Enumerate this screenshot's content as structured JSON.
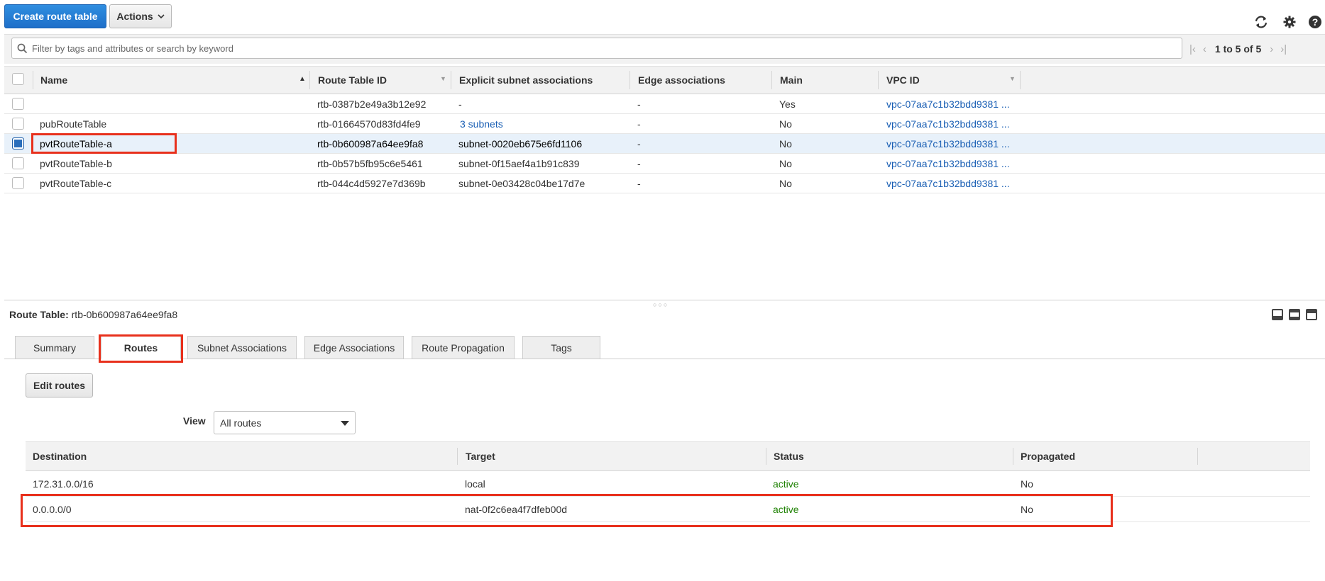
{
  "toolbar": {
    "create_label": "Create route table",
    "actions_label": "Actions",
    "icons": [
      "refresh-icon",
      "gear-icon",
      "help-icon"
    ]
  },
  "filter": {
    "placeholder": "Filter by tags and attributes or search by keyword",
    "pagination": "1 to 5 of 5"
  },
  "table": {
    "columns": {
      "name": "Name",
      "route_table_id": "Route Table ID",
      "explicit_subnet": "Explicit subnet associations",
      "edge": "Edge associations",
      "main": "Main",
      "vpc_id": "VPC ID"
    },
    "rows": [
      {
        "name": "",
        "id": "rtb-0387b2e49a3b12e92",
        "subnets": "-",
        "edge": "-",
        "main": "Yes",
        "vpc": "vpc-07aa7c1b32bdd9381 ..."
      },
      {
        "name": "pubRouteTable",
        "id": "rtb-01664570d83fd4fe9",
        "subnets": "3 subnets",
        "edge": "-",
        "main": "No",
        "vpc": "vpc-07aa7c1b32bdd9381 ..."
      },
      {
        "name": "pvtRouteTable-a",
        "id": "rtb-0b600987a64ee9fa8",
        "subnets": "subnet-0020eb675e6fd1106",
        "edge": "-",
        "main": "No",
        "vpc": "vpc-07aa7c1b32bdd9381 ..."
      },
      {
        "name": "pvtRouteTable-b",
        "id": "rtb-0b57b5fb95c6e5461",
        "subnets": "subnet-0f15aef4a1b91c839",
        "edge": "-",
        "main": "No",
        "vpc": "vpc-07aa7c1b32bdd9381 ..."
      },
      {
        "name": "pvtRouteTable-c",
        "id": "rtb-044c4d5927e7d369b",
        "subnets": "subnet-0e03428c04be17d7e",
        "edge": "-",
        "main": "No",
        "vpc": "vpc-07aa7c1b32bdd9381 ..."
      }
    ]
  },
  "detail": {
    "title_label": "Route Table:",
    "title_value": "rtb-0b600987a64ee9fa8",
    "tabs": [
      "Summary",
      "Routes",
      "Subnet Associations",
      "Edge Associations",
      "Route Propagation",
      "Tags"
    ],
    "edit_routes_label": "Edit routes",
    "view_label": "View",
    "view_value": "All routes",
    "routes_columns": {
      "destination": "Destination",
      "target": "Target",
      "status": "Status",
      "propagated": "Propagated"
    },
    "routes": [
      {
        "destination": "172.31.0.0/16",
        "target": "local",
        "status": "active",
        "propagated": "No"
      },
      {
        "destination": "0.0.0.0/0",
        "target": "nat-0f2c6ea4f7dfeb00d",
        "status": "active",
        "propagated": "No"
      }
    ]
  },
  "colors": {
    "primary": "#1e6fc9",
    "link": "#1a5fb4",
    "status_active": "#1d8102",
    "highlight": "#e8301c",
    "selected_row": "#e8f1fa"
  }
}
